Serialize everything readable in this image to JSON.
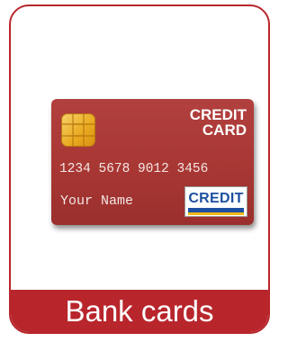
{
  "card": {
    "brand_line1": "CREDIT",
    "brand_line2": "CARD",
    "number": "1234 5678 9012 3456",
    "holder_name": "Your Name",
    "logo_text": "CREDIT"
  },
  "caption": "Bank cards",
  "colors": {
    "accent": "#b8262c",
    "card_body": "#a83734",
    "chip_gold": "#e9a91e",
    "logo_blue": "#1d4fa0",
    "logo_yellow": "#f2b817"
  },
  "icons": {
    "chip": "emv-chip-icon"
  }
}
